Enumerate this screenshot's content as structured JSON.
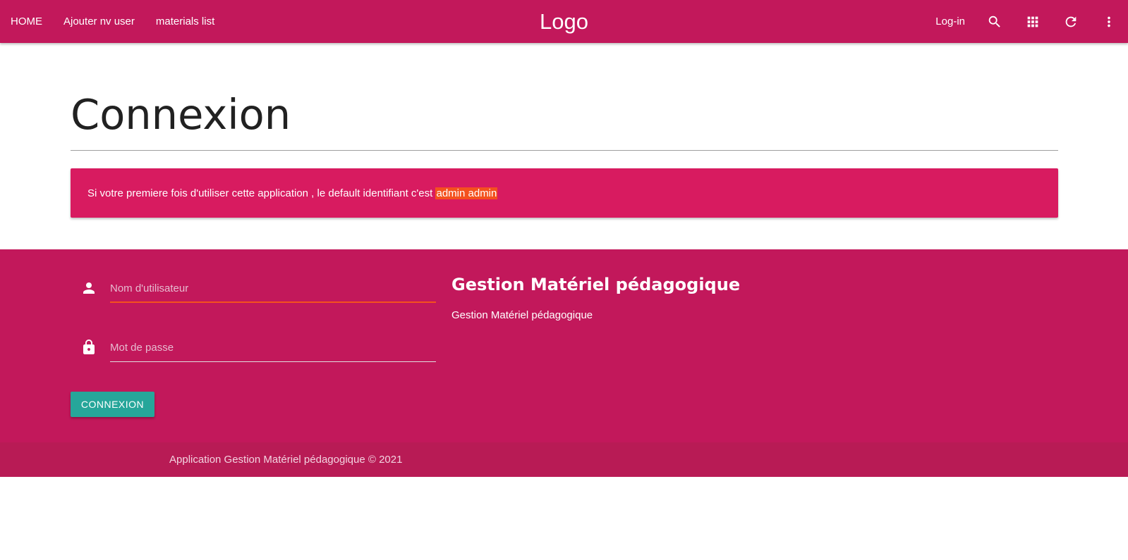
{
  "colors": {
    "primary": "#c2185b",
    "alert": "#d81b60",
    "highlight": "#f4511e",
    "button": "#26a69a"
  },
  "navbar": {
    "links": [
      "HOME",
      "Ajouter nv user",
      "materials list"
    ],
    "brand": "Logo",
    "login_label": "Log-in",
    "icons": [
      "search-icon",
      "apps-icon",
      "refresh-icon",
      "more-vert-icon"
    ]
  },
  "header": {
    "title": "Connexion"
  },
  "alert": {
    "text": "Si votre premiere fois d'utiliser cette application , le default identifiant c'est ",
    "highlight": "admin admin"
  },
  "login_form": {
    "username_placeholder": "Nom d'utilisateur",
    "username_value": "",
    "password_placeholder": "Mot de passe",
    "password_value": "",
    "submit_label": "CONNEXION"
  },
  "info": {
    "title": "Gestion Matériel pédagogique",
    "text": "Gestion Matériel pédagogique"
  },
  "footer": {
    "copyright": "Application Gestion Matériel pédagogique © 2021"
  }
}
